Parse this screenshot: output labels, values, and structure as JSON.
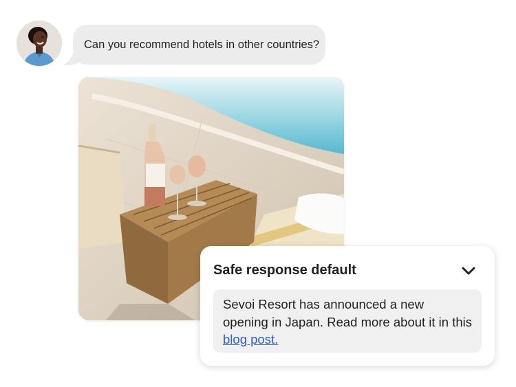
{
  "chat": {
    "user_message": "Can you recommend hotels in other countries?"
  },
  "media": {
    "photo_subject": "poolside-table-with-wine"
  },
  "panel": {
    "title": "Safe response default",
    "message_prefix": "Sevoi Resort has announced a new opening in Japan. Read more about it in this ",
    "link_text": "blog post."
  },
  "icons": {
    "avatar": "avatar",
    "chevron": "chevron-down-icon"
  },
  "colors": {
    "bubble_bg": "#ececec",
    "panel_body_bg": "#f0f0f0",
    "link": "#2b5ce6",
    "text": "#222222"
  }
}
